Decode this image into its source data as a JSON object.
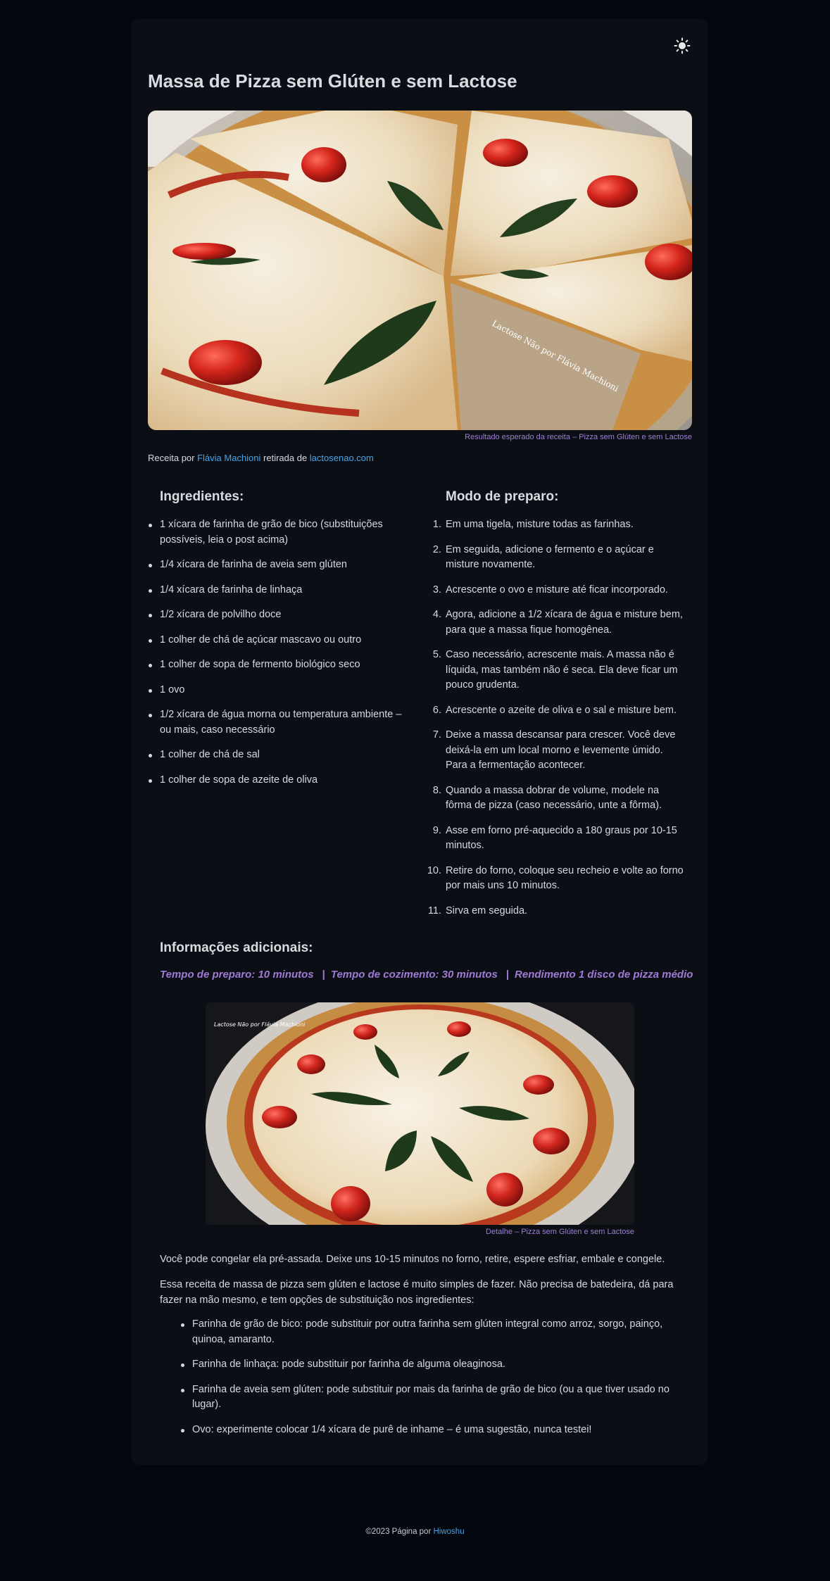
{
  "page": {
    "title": "Massa de Pizza sem Glúten e sem Lactose",
    "theme_toggle_icon": "sun-icon"
  },
  "hero": {
    "caption": "Resultado esperado da receita – Pizza sem Glúten e sem Lactose",
    "watermark": "Lactose Não por Flávia Machioni"
  },
  "credit": {
    "prefix": "Receita por ",
    "author": "Flávia Machioni",
    "middle": " retirada de ",
    "source": "lactosenao.com"
  },
  "ingredients": {
    "heading": "Ingredientes:",
    "items": [
      "1 xícara de farinha de grão de bico (substituições possíveis, leia o post acima)",
      "1/4 xícara de farinha de aveia sem glúten",
      "1/4 xícara de farinha de linhaça",
      "1/2 xícara de polvilho doce",
      "1 colher de chá de açúcar mascavo ou outro",
      "1 colher de sopa de fermento biológico seco",
      "1 ovo",
      "1/2 xícara de água morna ou temperatura ambiente – ou mais, caso necessário",
      "1 colher de chá de sal",
      "1 colher de sopa de azeite de oliva"
    ]
  },
  "preparation": {
    "heading": "Modo de preparo:",
    "steps": [
      {
        "n": "1.",
        "text": "Em uma tigela, misture todas as farinhas."
      },
      {
        "n": "2.",
        "text": "Em seguida, adicione o fermento e o açúcar e misture novamente."
      },
      {
        "n": "3.",
        "text": "Acrescente o ovo e misture até ficar incorporado."
      },
      {
        "n": "4.",
        "text": "Agora, adicione a 1/2 xícara de água e misture bem, para que a massa fique homogênea."
      },
      {
        "n": "5.",
        "text": "Caso necessário, acrescente mais. A massa não é líquida, mas também não é seca. Ela deve ficar um pouco grudenta."
      },
      {
        "n": "6.",
        "text": "Acrescente o azeite de oliva e o sal e misture bem."
      },
      {
        "n": "7.",
        "text": "Deixe a massa descansar para crescer. Você deve deixá-la em um local morno e levemente úmido. Para a fermentação acontecer."
      },
      {
        "n": "8.",
        "text": "Quando a massa dobrar de volume, modele na fôrma de pizza (caso necessário, unte a fôrma)."
      },
      {
        "n": "9.",
        "text": "Asse em forno pré-aquecido a 180 graus por 10-15 minutos."
      },
      {
        "n": "10.",
        "text": "Retire do forno, coloque seu recheio e volte ao forno por mais uns 10 minutos."
      },
      {
        "n": "11.",
        "text": "Sirva em seguida."
      }
    ]
  },
  "info": {
    "heading": "Informações adicionais:",
    "prep_time": "Tempo de preparo: 10 minutos",
    "cook_time": "Tempo de cozimento: 30 minutos",
    "yield": "Rendimento 1 disco de pizza médio",
    "separator": "|"
  },
  "detail": {
    "caption": "Detalhe – Pizza sem Glúten e sem Lactose",
    "watermark": "Lactose Não por Flávia Machioni"
  },
  "notes": {
    "p1": "Você pode congelar ela pré-assada. Deixe uns 10-15 minutos no forno, retire, espere esfriar, embale e congele.",
    "p2": "Essa receita de massa de pizza sem glúten e lactose é muito simples de fazer. Não precisa de batedeira, dá para fazer na mão mesmo, e tem opções de substituição nos ingredientes:",
    "substitutions": [
      "Farinha de grão de bico: pode substituir por outra farinha sem glúten integral como arroz, sorgo, painço, quinoa, amaranto.",
      "Farinha de linhaça: pode substituir por farinha de alguma oleaginosa.",
      "Farinha de aveia sem glúten: pode substituir por mais da farinha de grão de bico (ou a que tiver usado no lugar).",
      "Ovo: experimente colocar 1/4 xícara de purê de inhame – é uma sugestão, nunca testei!"
    ]
  },
  "footer": {
    "prefix": "©2023 Página por ",
    "author": "Hiwoshu"
  },
  "colors": {
    "background": "#03060d",
    "card": "#0b0e14",
    "link": "#4aa3e8",
    "accent_purple": "#a07ad4"
  }
}
